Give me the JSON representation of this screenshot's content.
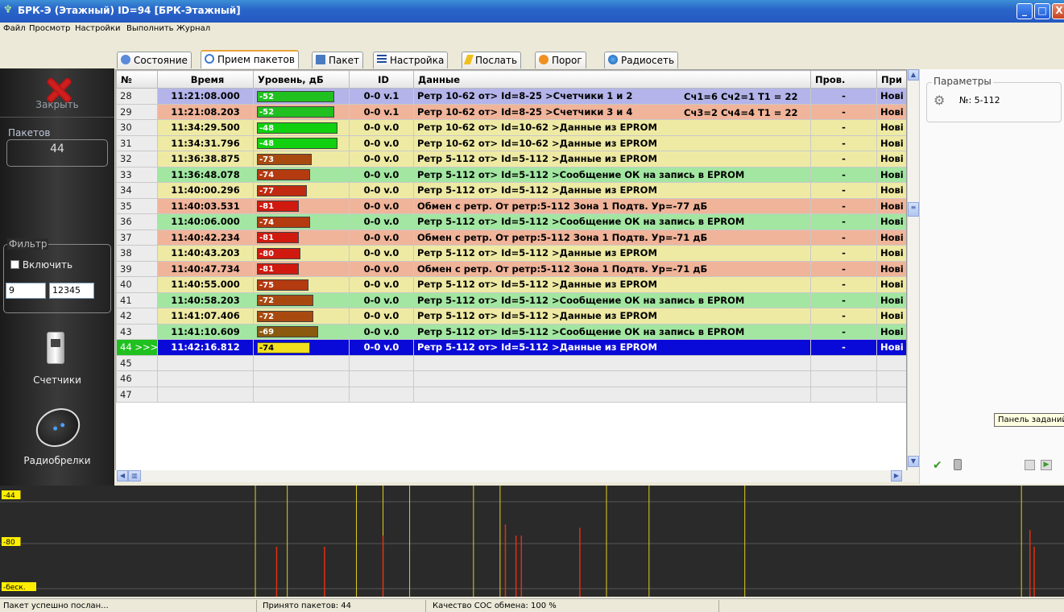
{
  "window": {
    "title": "БРК-Э  (Этажный)  ID=94 [БРК-Этажный]",
    "buttons": [
      "_",
      "□",
      "X"
    ]
  },
  "menu": [
    "Файл",
    "Просмотр",
    "Настройки",
    "Выполнить",
    "Журнал"
  ],
  "sidebar": {
    "close_label": "Закрыть",
    "packets_label": "Пакетов",
    "packets_count": "44",
    "filter_label": "Фильтр",
    "filter_enable": "Включить",
    "filter_val1": "9",
    "filter_val2": "12345",
    "counters_label": "Счетчики",
    "radio_label": "Радиобрелки"
  },
  "tabs": [
    "Состояние",
    "Прием пакетов",
    "Пакет",
    "Настройка",
    "Послать",
    "Порог",
    "Радиосеть"
  ],
  "active_tab": "Прием пакетов",
  "table": {
    "columns": [
      "№",
      "Время",
      "Уровень, дБ",
      "ID",
      "Данные",
      "Пров.",
      "При"
    ],
    "rows": [
      {
        "n": "28",
        "time": "11:21:08.000",
        "level": "-52",
        "lvl": 48,
        "lvlcolor": "#20c020",
        "id": "0-0 v.1",
        "data": "Ретр 10-62 от>  Id=8-25 >Счетчики 1 и 2",
        "extra": "Сч1=6 Сч2=1 Т1 = 22",
        "prov": "-",
        "pri": "Нові",
        "bg": "#b4b4ea"
      },
      {
        "n": "29",
        "time": "11:21:08.203",
        "level": "-52",
        "lvl": 48,
        "lvlcolor": "#20c020",
        "id": "0-0 v.1",
        "data": "Ретр 10-62 от>  Id=8-25 >Счетчики 3 и 4",
        "extra": "Сч3=2 Сч4=4 Т1 = 22",
        "prov": "-",
        "pri": "Нові",
        "bg": "#f0b49a"
      },
      {
        "n": "30",
        "time": "11:34:29.500",
        "level": "-48",
        "lvl": 50,
        "lvlcolor": "#10d010",
        "id": "0-0 v.0",
        "data": "Ретр 10-62 от>  Id=10-62 >Данные из EPROM",
        "extra": "",
        "prov": "-",
        "pri": "Нові",
        "bg": "#eeeaa4"
      },
      {
        "n": "31",
        "time": "11:34:31.796",
        "level": "-48",
        "lvl": 50,
        "lvlcolor": "#10d010",
        "id": "0-0 v.0",
        "data": "Ретр 10-62 от>  Id=10-62 >Данные из EPROM",
        "extra": "",
        "prov": "-",
        "pri": "Нові",
        "bg": "#eeeaa4"
      },
      {
        "n": "32",
        "time": "11:36:38.875",
        "level": "-73",
        "lvl": 34,
        "lvlcolor": "#a84a10",
        "id": "0-0 v.0",
        "data": "Ретр 5-112 от>  Id=5-112 >Данные из EPROM",
        "extra": "",
        "prov": "-",
        "pri": "Нові",
        "bg": "#eeeaa4"
      },
      {
        "n": "33",
        "time": "11:36:48.078",
        "level": "-74",
        "lvl": 33,
        "lvlcolor": "#b43a10",
        "id": "0-0 v.0",
        "data": "Ретр 5-112 от>  Id=5-112 >Сообщение ОК    на запись в EPROM",
        "extra": "",
        "prov": "-",
        "pri": "Нові",
        "bg": "#a2e6a2"
      },
      {
        "n": "34",
        "time": "11:40:00.296",
        "level": "-77",
        "lvl": 31,
        "lvlcolor": "#c02a10",
        "id": "0-0 v.0",
        "data": "Ретр 5-112 от>  Id=5-112 >Данные из EPROM",
        "extra": "",
        "prov": "-",
        "pri": "Нові",
        "bg": "#eeeaa4"
      },
      {
        "n": "35",
        "time": "11:40:03.531",
        "level": "-81",
        "lvl": 26,
        "lvlcolor": "#d01a10",
        "id": "0-0 v.0",
        "data": "Обмен с ретр.   От ретр:5-112 Зона 1 Подтв. Ур=-77 дБ",
        "extra": "",
        "prov": "-",
        "pri": "Нові",
        "bg": "#f0b49a"
      },
      {
        "n": "36",
        "time": "11:40:06.000",
        "level": "-74",
        "lvl": 33,
        "lvlcolor": "#b43a10",
        "id": "0-0 v.0",
        "data": "Ретр 5-112 от>  Id=5-112 >Сообщение ОК    на запись в EPROM",
        "extra": "",
        "prov": "-",
        "pri": "Нові",
        "bg": "#a2e6a2"
      },
      {
        "n": "37",
        "time": "11:40:42.234",
        "level": "-81",
        "lvl": 26,
        "lvlcolor": "#d01a10",
        "id": "0-0 v.0",
        "data": "Обмен с ретр.   От ретр:5-112 Зона 1 Подтв. Ур=-71 дБ",
        "extra": "",
        "prov": "-",
        "pri": "Нові",
        "bg": "#f0b49a"
      },
      {
        "n": "38",
        "time": "11:40:43.203",
        "level": "-80",
        "lvl": 27,
        "lvlcolor": "#d01a10",
        "id": "0-0 v.0",
        "data": "Ретр 5-112 от>  Id=5-112 >Данные из EPROM",
        "extra": "",
        "prov": "-",
        "pri": "Нові",
        "bg": "#eeeaa4"
      },
      {
        "n": "39",
        "time": "11:40:47.734",
        "level": "-81",
        "lvl": 26,
        "lvlcolor": "#d01a10",
        "id": "0-0 v.0",
        "data": "Обмен с ретр.   От ретр:5-112 Зона 1 Подтв. Ур=-71 дБ",
        "extra": "",
        "prov": "-",
        "pri": "Нові",
        "bg": "#f0b49a"
      },
      {
        "n": "40",
        "time": "11:40:55.000",
        "level": "-75",
        "lvl": 32,
        "lvlcolor": "#b43a10",
        "id": "0-0 v.0",
        "data": "Ретр 5-112 от>  Id=5-112 >Данные из EPROM",
        "extra": "",
        "prov": "-",
        "pri": "Нові",
        "bg": "#eeeaa4"
      },
      {
        "n": "41",
        "time": "11:40:58.203",
        "level": "-72",
        "lvl": 35,
        "lvlcolor": "#a84a10",
        "id": "0-0 v.0",
        "data": "Ретр 5-112 от>  Id=5-112 >Сообщение ОК    на запись в EPROM",
        "extra": "",
        "prov": "-",
        "pri": "Нові",
        "bg": "#a2e6a2"
      },
      {
        "n": "42",
        "time": "11:41:07.406",
        "level": "-72",
        "lvl": 35,
        "lvlcolor": "#a84a10",
        "id": "0-0 v.0",
        "data": "Ретр 5-112 от>  Id=5-112 >Данные из EPROM",
        "extra": "",
        "prov": "-",
        "pri": "Нові",
        "bg": "#eeeaa4"
      },
      {
        "n": "43",
        "time": "11:41:10.609",
        "level": "-69",
        "lvl": 38,
        "lvlcolor": "#8a5a10",
        "id": "0-0 v.0",
        "data": "Ретр 5-112 от>  Id=5-112 >Сообщение ОК    на запись в EPROM",
        "extra": "",
        "prov": "-",
        "pri": "Нові",
        "bg": "#a2e6a2"
      },
      {
        "n": "44 >>>",
        "time": "11:42:16.812",
        "level": "-74",
        "lvl": 33,
        "lvlcolor": "#f0e020",
        "id": "0-0 v.0",
        "data": "Ретр 5-112 от>  Id=5-112 >Данные из EPROM",
        "extra": "",
        "prov": "-",
        "pri": "Нові",
        "bg": "#0a0ad8",
        "selected": true
      },
      {
        "n": "45",
        "time": "",
        "level": "",
        "lvl": 0,
        "lvlcolor": "",
        "id": "",
        "data": "",
        "extra": "",
        "prov": "",
        "pri": "",
        "bg": "#ececec"
      },
      {
        "n": "46",
        "time": "",
        "level": "",
        "lvl": 0,
        "lvlcolor": "",
        "id": "",
        "data": "",
        "extra": "",
        "prov": "",
        "pri": "",
        "bg": "#ececec"
      },
      {
        "n": "47",
        "time": "",
        "level": "",
        "lvl": 0,
        "lvlcolor": "",
        "id": "",
        "data": "",
        "extra": "",
        "prov": "",
        "pri": "",
        "bg": "#ececec"
      }
    ]
  },
  "right_panel": {
    "params_label": "Параметры",
    "param_value": "№: 5-112",
    "tooltip": "Панель заданий"
  },
  "graph": {
    "labels": [
      "-44",
      "-80",
      "-беск."
    ],
    "yellow_lines_pct": [
      0.24,
      0.27,
      0.335,
      0.36,
      0.385,
      0.445,
      0.47,
      0.57,
      0.61,
      0.7,
      0.96
    ],
    "red_bars": [
      {
        "x": 0.26,
        "h": 0.45
      },
      {
        "x": 0.305,
        "h": 0.45
      },
      {
        "x": 0.36,
        "h": 0.55
      },
      {
        "x": 0.475,
        "h": 0.65
      },
      {
        "x": 0.485,
        "h": 0.55
      },
      {
        "x": 0.49,
        "h": 0.55
      },
      {
        "x": 0.545,
        "h": 0.62
      },
      {
        "x": 0.968,
        "h": 0.6
      },
      {
        "x": 0.972,
        "h": 0.45
      }
    ]
  },
  "status": {
    "msg": "Пакет успешно послан...",
    "received": "Принято пакетов: 44",
    "quality": "Качество СОС обмена: 100 %"
  }
}
